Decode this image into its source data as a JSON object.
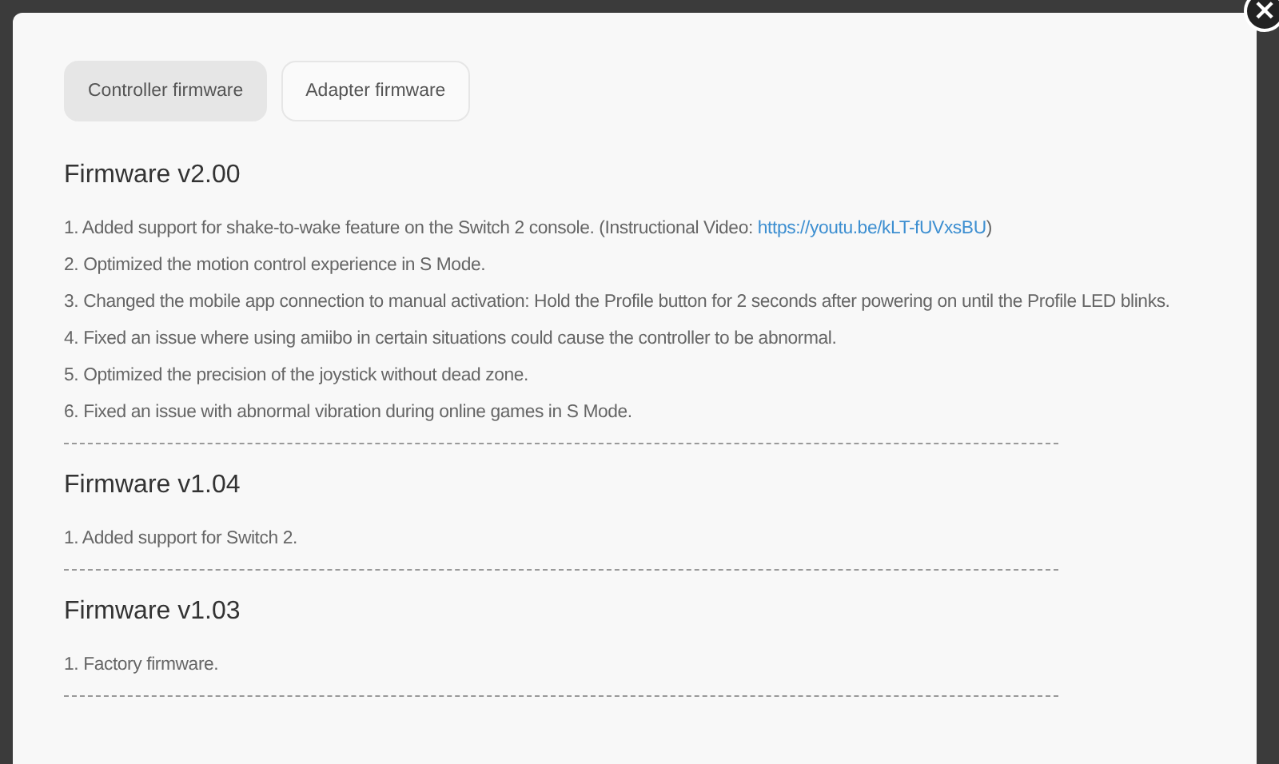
{
  "tabs": [
    {
      "label": "Controller firmware",
      "selected": true
    },
    {
      "label": "Adapter firmware",
      "selected": false
    }
  ],
  "close_button": {
    "label": "×"
  },
  "releases": [
    {
      "title": "Firmware v2.00",
      "items": [
        {
          "text": "1. Added support for shake-to-wake feature on the Switch 2 console. (Instructional Video: ",
          "link": "https://youtu.be/kLT-fUVxsBU",
          "after": ")"
        },
        {
          "text": "2. Optimized the motion control experience in S Mode."
        },
        {
          "text": "3. Changed the mobile app connection to manual activation: Hold the Profile button for 2 seconds after powering on until the Profile LED blinks."
        },
        {
          "text": "4. Fixed an issue where using amiibo in certain situations could cause the controller to be abnormal."
        },
        {
          "text": "5. Optimized the precision of the joystick without dead zone."
        },
        {
          "text": "6. Fixed an issue with abnormal vibration during online games in S Mode."
        }
      ]
    },
    {
      "title": "Firmware v1.04",
      "items": [
        {
          "text": "1. Added support for Switch 2."
        }
      ]
    },
    {
      "title": "Firmware v1.03",
      "items": [
        {
          "text": "1. Factory firmware."
        }
      ]
    }
  ]
}
